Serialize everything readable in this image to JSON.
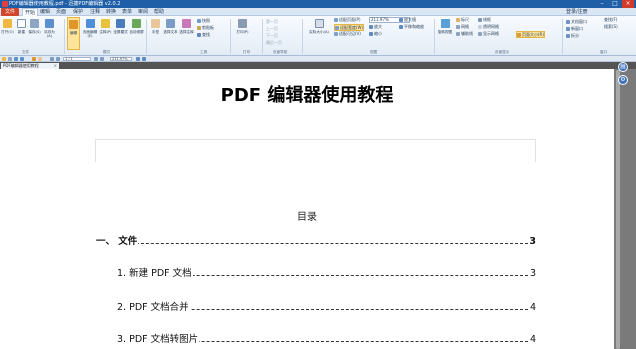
{
  "window": {
    "title": "PDF编辑器使用教程.pdf - 迅捷PDF编辑器 v2.0.2"
  },
  "menubar": {
    "file": "文件",
    "items": [
      "开始",
      "编辑",
      "页面",
      "保护",
      "注释",
      "转换",
      "表单",
      "审阅",
      "帮助"
    ],
    "user": "登录/注册",
    "find_label": "查找(F)",
    "search_label": "搜索(S)"
  },
  "ribbon": {
    "open": "打开(O)",
    "create": "新建",
    "save": "保存(S)",
    "save_as": "另存为(A)",
    "edit": "编辑",
    "page_edit": "页面编辑(E)",
    "annotate": "注释(P)",
    "full_mode": "全屏模式",
    "auto_scroll": "自动滚屏",
    "hand": "手型",
    "select_text": "选择文本",
    "select_note": "选择注释",
    "capture": "快照",
    "clipboard": "剪贴板",
    "find_btn": "查找",
    "print": "打印(P)",
    "first_page": "第一页",
    "prev_page": "上一页",
    "next_page": "下一页",
    "last_page": "最后一页",
    "actual_size": "实际大小(A)",
    "fit_page": "适配页面(P)",
    "fit_width": "适配宽度(W)",
    "fit_visible": "适配可见(V)",
    "zoom_value": "211.97%",
    "zoom_in": "放大",
    "zoom_out": "缩小",
    "loupe": "放大镜",
    "pan_zoom": "平移和缩放",
    "rotate_view": "旋转视图",
    "ruler": "标尺",
    "grid": "网格",
    "guides": "辅助线",
    "lines": "线框",
    "transparency": "透明网格",
    "show_grid": "显示网格",
    "page_size": "页面大小(R)",
    "docs": "文档窗口",
    "new_win": "新窗口",
    "split": "拆分",
    "g_file": "文件",
    "g_mode": "模式",
    "g_tools": "工具",
    "g_print": "打印",
    "g_nav": "页面导航",
    "g_view": "视图",
    "g_display": "页面显示",
    "g_window": "窗口"
  },
  "quickbar": {
    "page_field": "1 / 1",
    "zoom_field": "211.97%"
  },
  "tab": {
    "name": "PDF编辑器使用教程"
  },
  "document": {
    "title": "PDF 编辑器使用教程",
    "toc_heading": "目录",
    "toc": [
      {
        "text": "一、  文件",
        "page": "3"
      },
      {
        "text": "1.  新建 PDF 文档",
        "page": "3"
      },
      {
        "text": "2. PDF 文档合并",
        "page": "4"
      },
      {
        "text": "3. PDF 文档转图片",
        "page": "4"
      }
    ]
  },
  "colors": {
    "accent": "#1f5fa8",
    "file_menu": "#d2452d",
    "highlight": "#ffe49a"
  }
}
